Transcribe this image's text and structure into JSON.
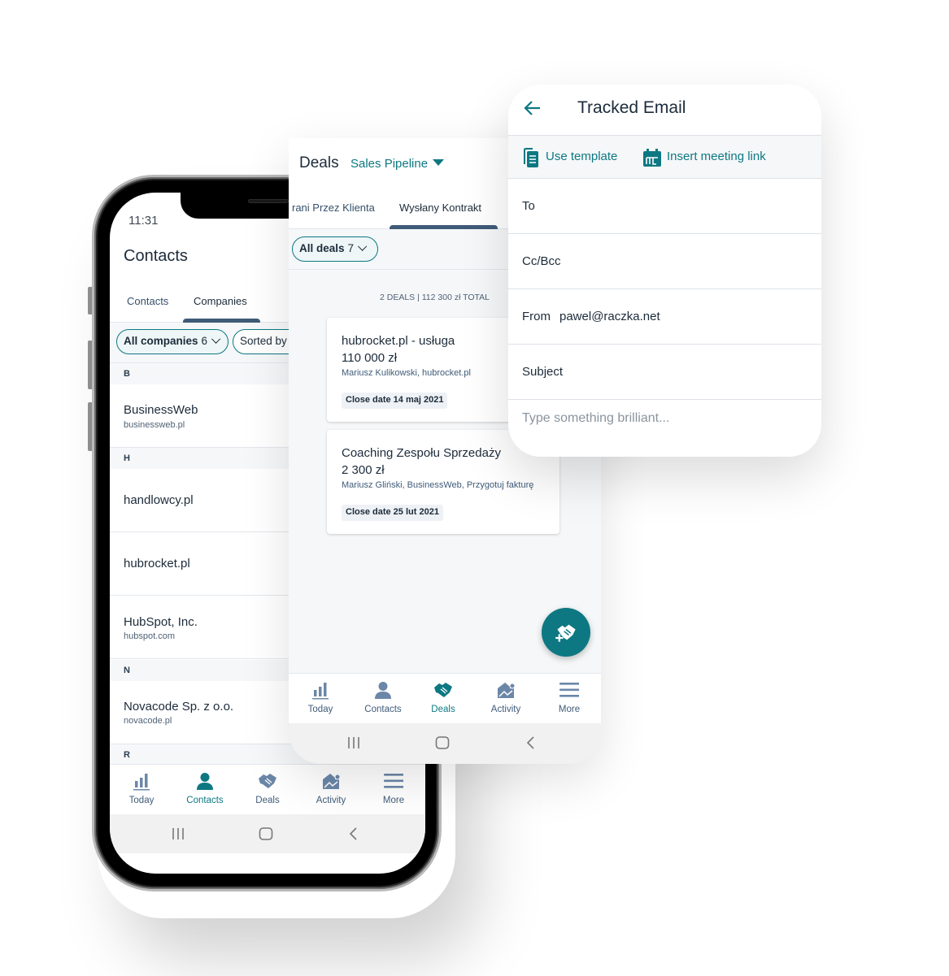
{
  "contacts_screen": {
    "status_time": "11:31",
    "title": "Contacts",
    "tabs": [
      {
        "label": "Contacts",
        "active": false
      },
      {
        "label": "Companies",
        "active": true
      }
    ],
    "filters": {
      "all_label": "All companies",
      "all_count": "6",
      "sort_label": "Sorted by"
    },
    "sections": [
      {
        "letter": "B",
        "items": [
          {
            "name": "BusinessWeb",
            "domain": "businessweb.pl"
          }
        ]
      },
      {
        "letter": "H",
        "items": [
          {
            "name": "handlowcy.pl",
            "domain": ""
          },
          {
            "name": "hubrocket.pl",
            "domain": ""
          },
          {
            "name": "HubSpot, Inc.",
            "domain": "hubspot.com"
          }
        ]
      },
      {
        "letter": "N",
        "items": [
          {
            "name": "Novacode Sp. z o.o.",
            "domain": "novacode.pl"
          }
        ]
      },
      {
        "letter": "R",
        "items": []
      }
    ],
    "bottom_nav": [
      {
        "label": "Today",
        "icon": "bar-chart-icon",
        "active": false
      },
      {
        "label": "Contacts",
        "icon": "person-icon",
        "active": true
      },
      {
        "label": "Deals",
        "icon": "handshake-icon",
        "active": false
      },
      {
        "label": "Activity",
        "icon": "activity-icon",
        "active": false
      },
      {
        "label": "More",
        "icon": "menu-icon",
        "active": false
      }
    ]
  },
  "deals_screen": {
    "title": "Deals",
    "pipeline": "Sales Pipeline",
    "tabs": [
      {
        "label": "rani Przez Klienta",
        "active": false
      },
      {
        "label": "Wysłany Kontrakt",
        "active": true
      }
    ],
    "filter": {
      "label": "All deals",
      "count": "7"
    },
    "summary": "2 DEALS   |   112 300 zł TOTAL",
    "deals": [
      {
        "name": "hubrocket.pl  - usługa",
        "value": "110 000 zł",
        "people": "Mariusz Kulikowski, hubrocket.pl",
        "close_date": "Close date 14 maj 2021"
      },
      {
        "name": "Coaching Zespołu Sprzedaży",
        "value": "2 300 zł",
        "people": "Mariusz Gliński, BusinessWeb, Przygotuj fakturę",
        "close_date": "Close date 25 lut 2021"
      }
    ],
    "fab_icon": "add-deal-icon",
    "bottom_nav": [
      {
        "label": "Today",
        "icon": "bar-chart-icon",
        "active": false
      },
      {
        "label": "Contacts",
        "icon": "person-icon",
        "active": false
      },
      {
        "label": "Deals",
        "icon": "handshake-icon",
        "active": true
      },
      {
        "label": "Activity",
        "icon": "activity-icon",
        "active": false
      },
      {
        "label": "More",
        "icon": "menu-icon",
        "active": false
      }
    ]
  },
  "email_screen": {
    "title": "Tracked Email",
    "toolbar": {
      "use_template": "Use template",
      "insert_meeting_link": "Insert meeting link"
    },
    "fields": [
      {
        "label": "To",
        "value": ""
      },
      {
        "label": "Cc/Bcc",
        "value": ""
      },
      {
        "label": "From",
        "value": "pawel@raczka.net"
      },
      {
        "label": "Subject",
        "value": ""
      }
    ],
    "body_placeholder": "Type something brilliant..."
  },
  "colors": {
    "accent": "#0d7882",
    "nav_inactive": "#6b87a8",
    "text_primary": "#1c2b3a",
    "tab_indicator": "#3f5b78"
  }
}
